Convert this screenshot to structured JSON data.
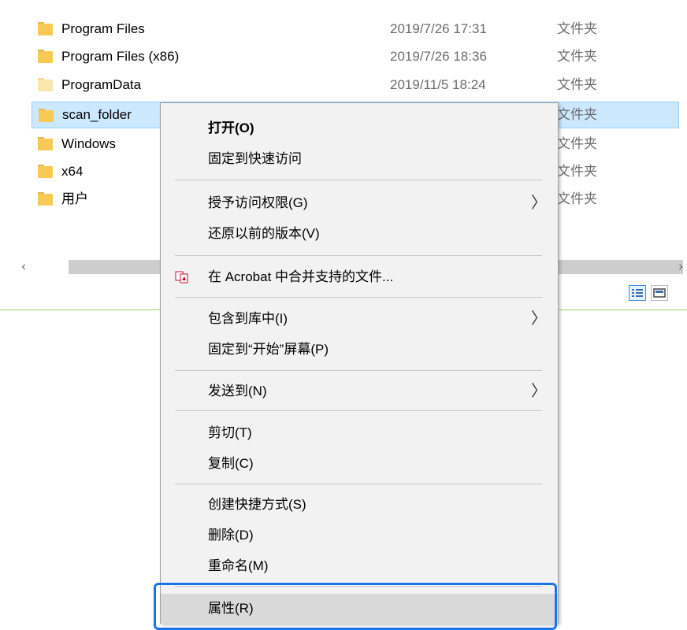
{
  "files": [
    {
      "name": "Program Files",
      "date": "2019/7/26 17:31",
      "type": "文件夹",
      "pale": false,
      "selected": false
    },
    {
      "name": "Program Files (x86)",
      "date": "2019/7/26 18:36",
      "type": "文件夹",
      "pale": false,
      "selected": false
    },
    {
      "name": "ProgramData",
      "date": "2019/11/5 18:24",
      "type": "文件夹",
      "pale": true,
      "selected": false
    },
    {
      "name": "scan_folder",
      "date": "",
      "type": "文件夹",
      "pale": false,
      "selected": true
    },
    {
      "name": "Windows",
      "date": "",
      "type": "文件夹",
      "pale": false,
      "selected": false
    },
    {
      "name": "x64",
      "date": "",
      "type": "文件夹",
      "pale": false,
      "selected": false
    },
    {
      "name": "用户",
      "date": "",
      "type": "文件夹",
      "pale": false,
      "selected": false
    }
  ],
  "scrollbar": {
    "left_arrow": "‹",
    "right_arrow": "›"
  },
  "context_menu": {
    "open": "打开(O)",
    "pin_quick_access": "固定到快速访问",
    "grant_access": "授予访问权限(G)",
    "restore_versions": "还原以前的版本(V)",
    "acrobat_merge": "在 Acrobat 中合并支持的文件...",
    "include_library": "包含到库中(I)",
    "pin_start": "固定到“开始”屏幕(P)",
    "send_to": "发送到(N)",
    "cut": "剪切(T)",
    "copy": "复制(C)",
    "create_shortcut": "创建快捷方式(S)",
    "delete": "删除(D)",
    "rename": "重命名(M)",
    "properties": "属性(R)",
    "submenu_arrow": "〉"
  },
  "colors": {
    "accent_highlight": "#1a73e8",
    "selection": "#cce8ff",
    "folder": "#f8c954"
  }
}
